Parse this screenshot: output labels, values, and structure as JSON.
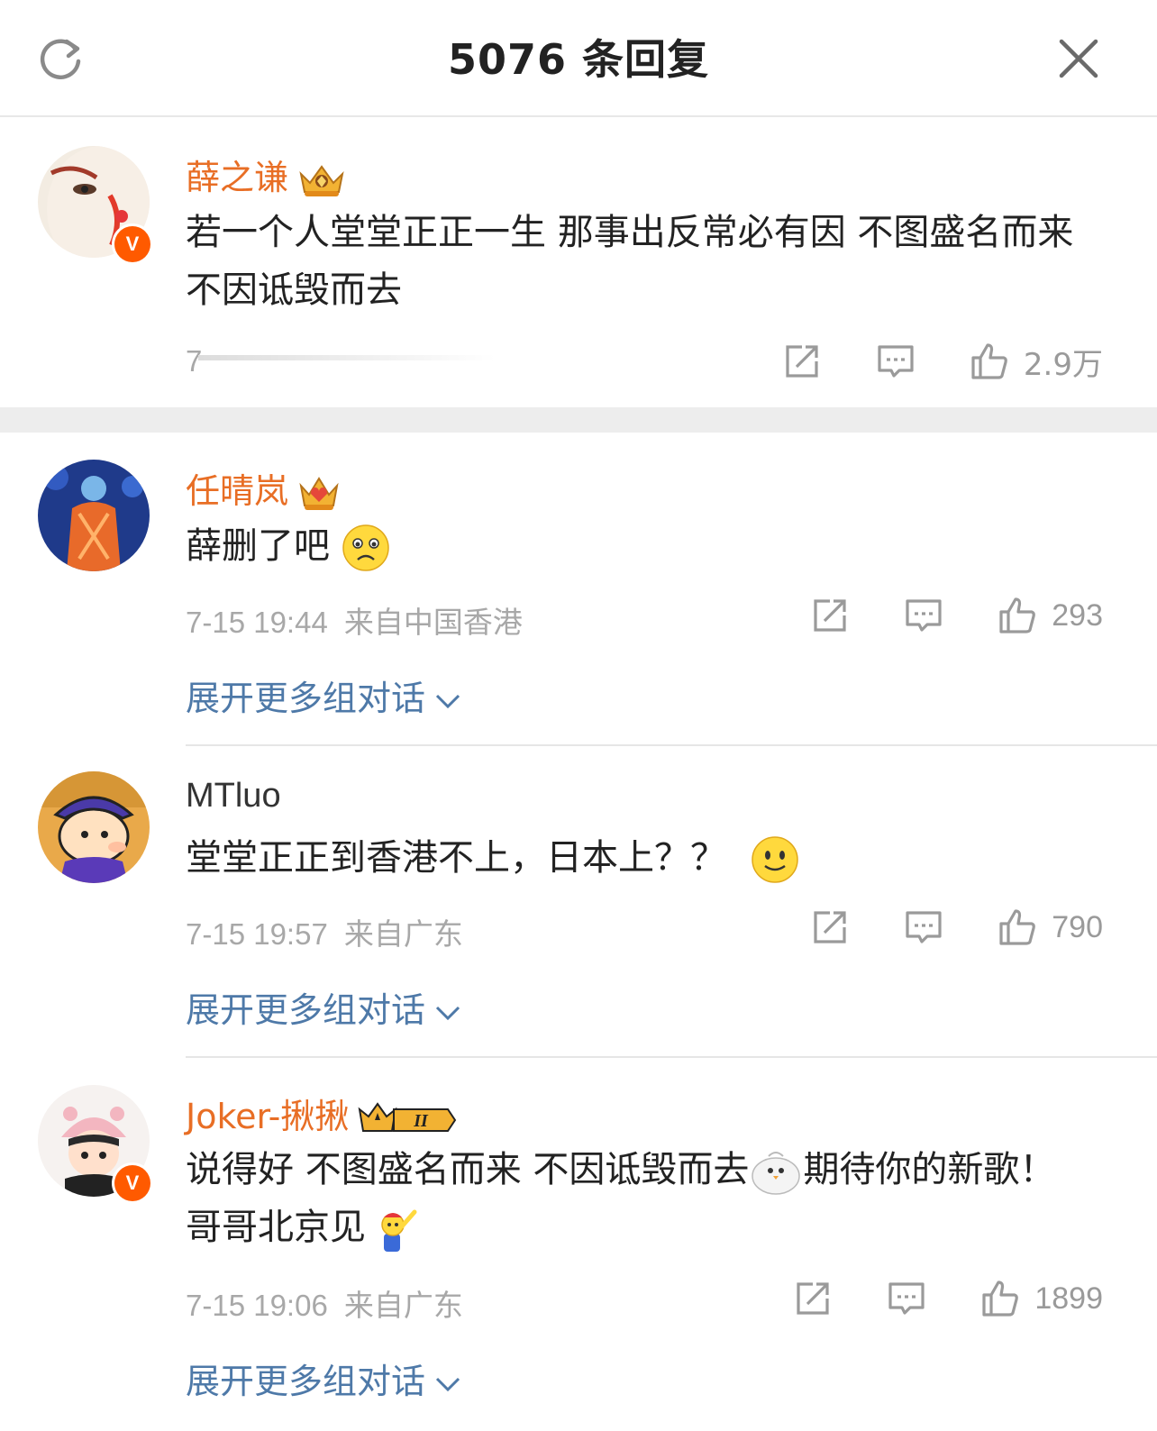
{
  "header": {
    "title": "5076 条回复",
    "refresh_icon": "refresh-icon",
    "close_icon": "close-icon"
  },
  "colors": {
    "username": "#e86e25",
    "link": "#4e79a8",
    "meta": "#a8a8a8",
    "verified_badge": "#ff6600"
  },
  "comments": [
    {
      "username": "薛之谦",
      "text": "若一个人堂堂正正一生 那事出反常必有因 不图盛名而来 不因诋毁而去",
      "time": "7",
      "location": "",
      "likes": "2.9万",
      "verified": true
    },
    {
      "username": "任晴岚",
      "text": "薛删了吧",
      "time": "7-15 19:44",
      "location": "来自中国香港",
      "likes": "293",
      "expand": "展开更多组对话"
    },
    {
      "username": "MTluo",
      "text": "堂堂正正到香港不上，日本上？？",
      "time": "7-15 19:57",
      "location": "来自广东",
      "likes": "790",
      "expand": "展开更多组对话"
    },
    {
      "username": "Joker-揪揪",
      "text_part1": "说得好 不图盛名而来 不因诋毁而去",
      "text_part2": "期待你的新歌！哥哥北京见",
      "time": "7-15 19:06",
      "location": "来自广东",
      "likes": "1899",
      "expand": "展开更多组对话",
      "verified": true,
      "member_level": "II"
    }
  ]
}
